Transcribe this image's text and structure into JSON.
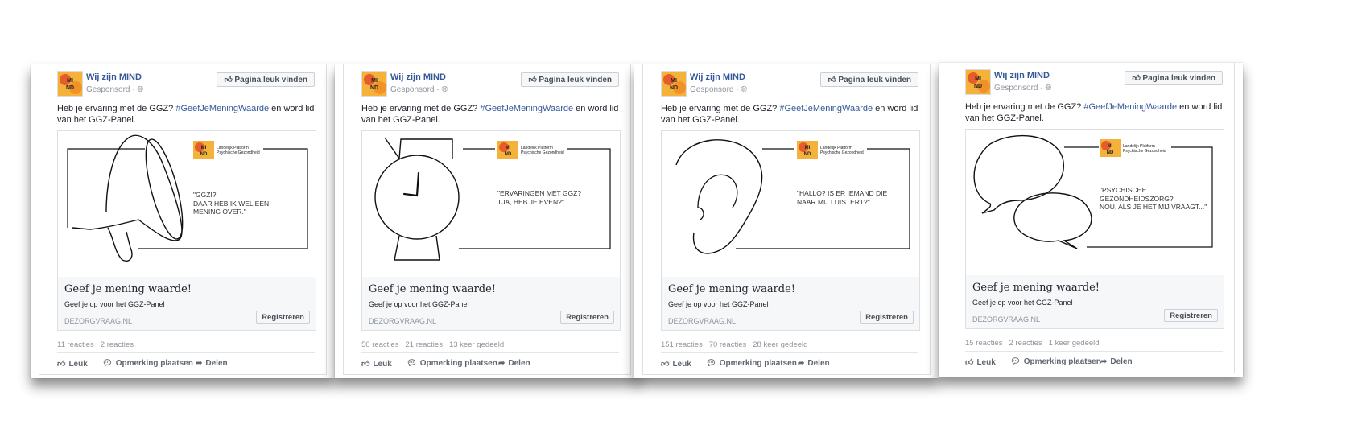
{
  "posts": [
    {
      "page_name": "Wij zijn MIND",
      "sponsored": "Gesponsord",
      "like_page_label": "Pagina leuk vinden",
      "text_before": "Heb je ervaring met de GGZ? ",
      "hashtag": "#GeefJeMeningWaarde",
      "text_after": " en word lid van het GGZ-Panel.",
      "creative_icon": "megaphone-illustration",
      "quote": "\"GGZ!?\nDAAR HEB IK WEL EEN MENING OVER.\"",
      "headline": "Geef je mening waarde!",
      "subline": "Geef je op voor het GGZ-Panel",
      "domain": "DEZORGVRAAG.NL",
      "cta": "Registreren",
      "reactions": "11 reacties",
      "comments": "2 reacties",
      "shares": "",
      "like_label": "Leuk",
      "comment_label": "Opmerking plaatsen",
      "share_label": "Delen"
    },
    {
      "page_name": "Wij zijn MIND",
      "sponsored": "Gesponsord",
      "like_page_label": "Pagina leuk vinden",
      "text_before": "Heb je ervaring met de GGZ? ",
      "hashtag": "#GeefJeMeningWaarde",
      "text_after": " en word lid van het GGZ-Panel.",
      "creative_icon": "watch-illustration",
      "quote": "\"ERVARINGEN MET GGZ?\nTJA, HEB JE EVEN?\"",
      "headline": "Geef je mening waarde!",
      "subline": "Geef je op voor het GGZ-Panel",
      "domain": "DEZORGVRAAG.NL",
      "cta": "Registreren",
      "reactions": "50 reacties",
      "comments": "21 reacties",
      "shares": "13 keer gedeeld",
      "like_label": "Leuk",
      "comment_label": "Opmerking plaatsen",
      "share_label": "Delen"
    },
    {
      "page_name": "Wij zijn MIND",
      "sponsored": "Gesponsord",
      "like_page_label": "Pagina leuk vinden",
      "text_before": "Heb je ervaring met de GGZ? ",
      "hashtag": "#GeefJeMeningWaarde",
      "text_after": " en word lid van het GGZ-Panel.",
      "creative_icon": "ear-illustration",
      "quote": "\"HALLO? IS ER IEMAND DIE\nNAAR MIJ LUISTERT?\"",
      "headline": "Geef je mening waarde!",
      "subline": "Geef je op voor het GGZ-Panel",
      "domain": "DEZORGVRAAG.NL",
      "cta": "Registreren",
      "reactions": "151 reacties",
      "comments": "70 reacties",
      "shares": "28 keer gedeeld",
      "like_label": "Leuk",
      "comment_label": "Opmerking plaatsen",
      "share_label": "Delen"
    },
    {
      "page_name": "Wij zijn MIND",
      "sponsored": "Gesponsord",
      "like_page_label": "Pagina leuk vinden",
      "text_before": "Heb je ervaring met de GGZ? ",
      "hashtag": "#GeefJeMeningWaarde",
      "text_after": " en word lid van het GGZ-Panel.",
      "creative_icon": "speech-bubbles-illustration",
      "quote": "\"PSYCHISCHE\nGEZONDHEIDSZORG?\nNOU, ALS JE HET MIJ VRAAGT...\"",
      "headline": "Geef je mening waarde!",
      "subline": "Geef je op voor het GGZ-Panel",
      "domain": "DEZORGVRAAG.NL",
      "cta": "Registreren",
      "reactions": "15 reacties",
      "comments": "2 reacties",
      "shares": "1 keer gedeeld",
      "like_label": "Leuk",
      "comment_label": "Opmerking plaatsen",
      "share_label": "Delen"
    }
  ],
  "logo_text": "MI ND",
  "platform_label": {
    "line1": "Landelijk Platform",
    "line2": "Psychische Gezondheid"
  },
  "colors": {
    "link": "#365899",
    "logo_orange": "#f4b23a",
    "logo_red": "#e2462b"
  }
}
